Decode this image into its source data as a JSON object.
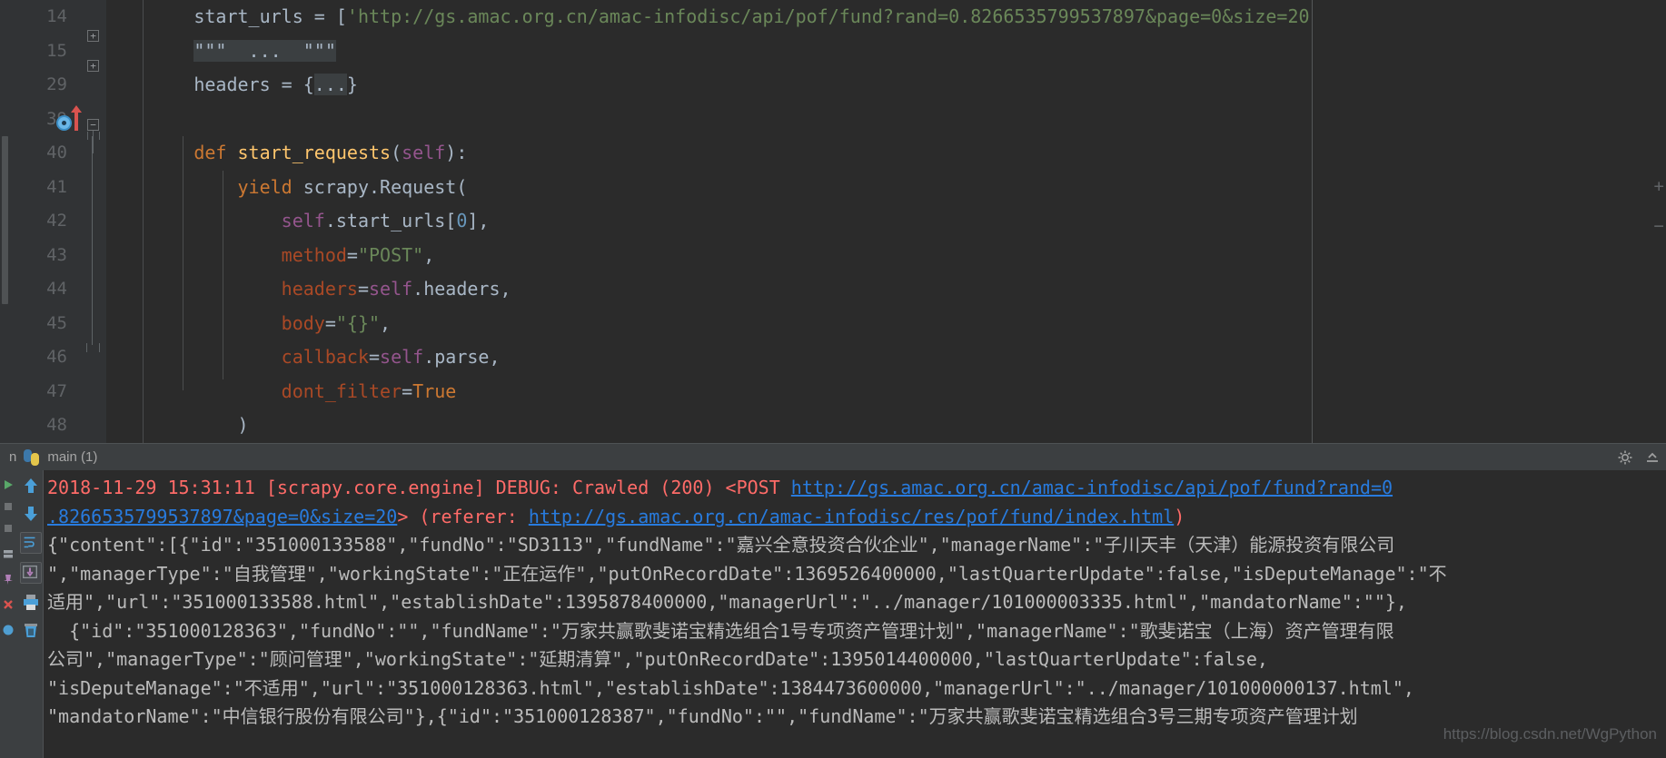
{
  "editor": {
    "lines": [
      {
        "num": "14",
        "fold": null,
        "tokens": [
          {
            "t": "        ",
            "c": "t-plain"
          },
          {
            "t": "start_urls",
            "c": "t-plain"
          },
          {
            "t": " = [",
            "c": "t-plain"
          },
          {
            "t": "'http://gs.amac.org.cn/amac-infodisc/api/pof/fund?rand=0.8266535799537897&page=0&size=20'",
            "c": "t-str"
          },
          {
            "t": "]",
            "c": "t-plain"
          }
        ]
      },
      {
        "num": "15",
        "fold": "plus",
        "tokens": [
          {
            "t": "        ",
            "c": "t-plain"
          },
          {
            "t": "\"\"\"  ...  \"\"\"",
            "c": "t-docfold"
          }
        ]
      },
      {
        "num": "29",
        "fold": "plus",
        "tokens": [
          {
            "t": "        ",
            "c": "t-plain"
          },
          {
            "t": "headers",
            "c": "t-plain"
          },
          {
            "t": " = {",
            "c": "t-plain"
          },
          {
            "t": "...",
            "c": "t-fold"
          },
          {
            "t": "}",
            "c": "t-plain"
          }
        ]
      },
      {
        "num": "39",
        "fold": null,
        "tokens": []
      },
      {
        "num": "40",
        "fold": "minus",
        "tokens": [
          {
            "t": "        ",
            "c": "t-plain"
          },
          {
            "t": "def ",
            "c": "t-def"
          },
          {
            "t": "start_requests",
            "c": "t-func"
          },
          {
            "t": "(",
            "c": "t-plain"
          },
          {
            "t": "self",
            "c": "t-self"
          },
          {
            "t": "):",
            "c": "t-plain"
          }
        ]
      },
      {
        "num": "41",
        "fold": null,
        "tokens": [
          {
            "t": "            ",
            "c": "t-plain"
          },
          {
            "t": "yield ",
            "c": "t-kw"
          },
          {
            "t": "scrapy.Request(",
            "c": "t-plain"
          }
        ]
      },
      {
        "num": "42",
        "fold": null,
        "tokens": [
          {
            "t": "                ",
            "c": "t-plain"
          },
          {
            "t": "self",
            "c": "t-self"
          },
          {
            "t": ".start_urls[",
            "c": "t-plain"
          },
          {
            "t": "0",
            "c": "t-num"
          },
          {
            "t": "],",
            "c": "t-plain"
          }
        ]
      },
      {
        "num": "43",
        "fold": null,
        "tokens": [
          {
            "t": "                ",
            "c": "t-plain"
          },
          {
            "t": "method",
            "c": "t-kwarg"
          },
          {
            "t": "=",
            "c": "t-plain"
          },
          {
            "t": "\"POST\"",
            "c": "t-str"
          },
          {
            "t": ",",
            "c": "t-plain"
          }
        ]
      },
      {
        "num": "44",
        "fold": null,
        "tokens": [
          {
            "t": "                ",
            "c": "t-plain"
          },
          {
            "t": "headers",
            "c": "t-kwarg"
          },
          {
            "t": "=",
            "c": "t-plain"
          },
          {
            "t": "self",
            "c": "t-self"
          },
          {
            "t": ".headers,",
            "c": "t-plain"
          }
        ]
      },
      {
        "num": "45",
        "fold": null,
        "tokens": [
          {
            "t": "                ",
            "c": "t-plain"
          },
          {
            "t": "body",
            "c": "t-kwarg"
          },
          {
            "t": "=",
            "c": "t-plain"
          },
          {
            "t": "\"{}\"",
            "c": "t-str"
          },
          {
            "t": ",",
            "c": "t-plain"
          }
        ]
      },
      {
        "num": "46",
        "fold": null,
        "tokens": [
          {
            "t": "                ",
            "c": "t-plain"
          },
          {
            "t": "callback",
            "c": "t-kwarg"
          },
          {
            "t": "=",
            "c": "t-plain"
          },
          {
            "t": "self",
            "c": "t-self"
          },
          {
            "t": ".parse,",
            "c": "t-plain"
          }
        ]
      },
      {
        "num": "47",
        "fold": null,
        "tokens": [
          {
            "t": "                ",
            "c": "t-plain"
          },
          {
            "t": "dont_filter",
            "c": "t-kwarg"
          },
          {
            "t": "=",
            "c": "t-plain"
          },
          {
            "t": "True",
            "c": "t-kw"
          }
        ]
      },
      {
        "num": "48",
        "fold": null,
        "tokens": [
          {
            "t": "            ",
            "c": "t-plain"
          },
          {
            "t": ")",
            "c": "t-plain"
          }
        ]
      }
    ]
  },
  "tool_window": {
    "tab_label": "main (1)",
    "tab_icon": "python-icon",
    "settings_icon": "gear-icon",
    "minimize_icon": "minimize-icon",
    "toolbar_buttons": [
      {
        "name": "scroll-up-button",
        "icon": "arrow-up-icon"
      },
      {
        "name": "scroll-down-button",
        "icon": "arrow-down-icon"
      },
      {
        "name": "soft-wrap-button",
        "icon": "soft-wrap-icon"
      },
      {
        "name": "scroll-to-end-button",
        "icon": "scroll-to-end-icon"
      },
      {
        "name": "print-button",
        "icon": "print-icon"
      },
      {
        "name": "clear-all-button",
        "icon": "trash-icon"
      }
    ],
    "side_buttons": [
      {
        "name": "rerun-button",
        "icon": "run-green-icon"
      },
      {
        "name": "stop-button",
        "icon": "stop-icon"
      },
      {
        "name": "pause-button",
        "icon": "pause-icon"
      },
      {
        "name": "filter-button",
        "icon": "filter-icon"
      },
      {
        "name": "close-button",
        "icon": "close-red-icon"
      },
      {
        "name": "help-button",
        "icon": "help-icon"
      }
    ]
  },
  "console": {
    "lines": [
      {
        "segments": [
          {
            "t": "2018-11-29 15:31:11 [scrapy.core.engine] DEBUG: Crawled (200) <POST ",
            "c": "c-err"
          },
          {
            "t": "http://gs.amac.org.cn/amac-infodisc/api/pof/fund?rand=0",
            "c": "c-link"
          }
        ]
      },
      {
        "segments": [
          {
            "t": ".826653579953789",
            "c": "c-link"
          },
          {
            "t": "7&page=0&size=20",
            "c": "c-link"
          },
          {
            "t": "> (referer: ",
            "c": "c-err"
          },
          {
            "t": "http://gs.amac.org.cn/amac-infodisc/res/pof/fund/index.html",
            "c": "c-link"
          },
          {
            "t": ")",
            "c": "c-err"
          }
        ]
      },
      {
        "segments": [
          {
            "t": "{\"content\":[{\"id\":\"351000133588\",\"fundNo\":\"SD3113\",\"fundName\":\"嘉兴全意投资合伙企业\",\"managerName\":\"子川天丰（天津）能源投资有限公司",
            "c": "c-out"
          }
        ]
      },
      {
        "segments": [
          {
            "t": "\",\"managerType\":\"自我管理\",\"workingState\":\"正在运作\",\"putOnRecordDate\":1369526400000,\"lastQuarterUpdate\":false,\"isDeputeManage\":\"不",
            "c": "c-out"
          }
        ]
      },
      {
        "segments": [
          {
            "t": "适用\",\"url\":\"351000133588.html\",\"establishDate\":1395878400000,\"managerUrl\":\"../manager/101000003335.html\",\"mandatorName\":\"\"},",
            "c": "c-out"
          }
        ]
      },
      {
        "segments": [
          {
            "t": "  {\"id\":\"351000128363\",\"fundNo\":\"\",\"fundName\":\"万家共赢歌斐诺宝精选组合1号专项资产管理计划\",\"managerName\":\"歌斐诺宝（上海）资产管理有限",
            "c": "c-out"
          }
        ]
      },
      {
        "segments": [
          {
            "t": "公司\",\"managerType\":\"顾问管理\",\"workingState\":\"延期清算\",\"putOnRecordDate\":1395014400000,\"lastQuarterUpdate\":false,",
            "c": "c-out"
          }
        ]
      },
      {
        "segments": [
          {
            "t": "\"isDeputeManage\":\"不适用\",\"url\":\"351000128363.html\",\"establishDate\":1384473600000,\"managerUrl\":\"../manager/101000000137.html\",",
            "c": "c-out"
          }
        ]
      },
      {
        "segments": [
          {
            "t": "\"mandatorName\":\"中信银行股份有限公司\"},{\"id\":\"351000128387\",\"fundNo\":\"\",\"fundName\":\"万家共赢歌斐诺宝精选组合3号三期专项资产管理计划",
            "c": "c-out"
          }
        ]
      }
    ],
    "watermark": "https://blog.csdn.net/WgPython"
  },
  "colors": {
    "background": "#2b2b2b",
    "panel": "#3c3f41",
    "gutter": "#313335",
    "error_text": "#ff6b68",
    "link": "#287bde",
    "output_text": "#bbbbbb",
    "keyword": "#cc7832",
    "string": "#6a8759",
    "self": "#94558d",
    "function": "#ffc66d",
    "number": "#6897bb"
  }
}
